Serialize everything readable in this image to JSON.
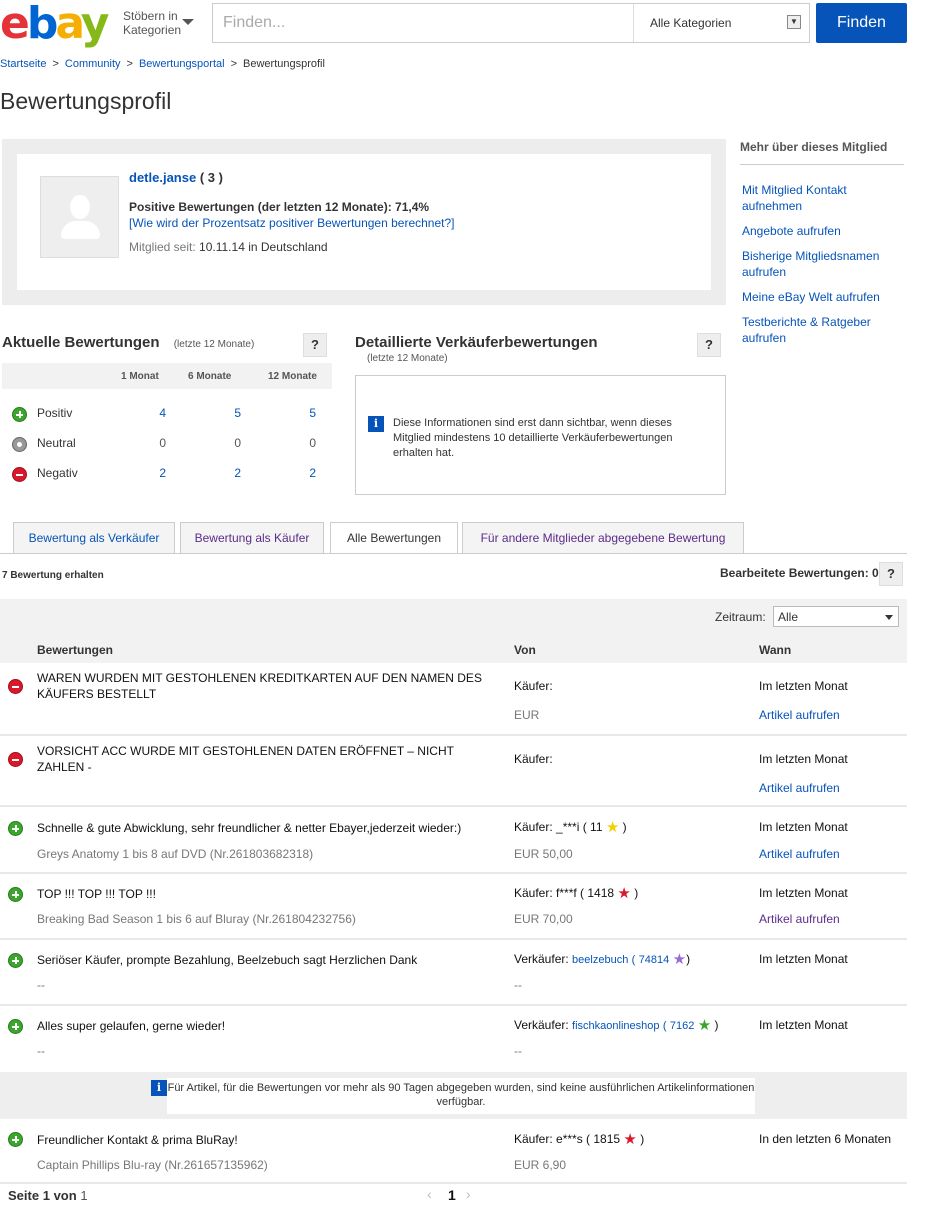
{
  "header": {
    "logo": [
      "e",
      "b",
      "a",
      "y"
    ],
    "browse_line1": "Stöbern in",
    "browse_line2": "Kategorien",
    "search_placeholder": "Finden...",
    "category": "Alle Kategorien",
    "find_button": "Finden"
  },
  "breadcrumb": [
    "Startseite",
    "Community",
    "Bewertungsportal",
    "Bewertungsprofil"
  ],
  "page_title": "Bewertungsprofil",
  "profile": {
    "username": "detle.janse",
    "score": "( 3 )",
    "positive_line": "Positive Bewertungen (der letzten 12 Monate): 71,4%",
    "percent_link": "[Wie wird der Prozentsatz positiver Bewertungen berechnet?]",
    "member_label": "Mitglied seit:",
    "member_value": "10.11.14 in Deutschland"
  },
  "sidebar": {
    "title": "Mehr über dieses Mitglied",
    "links": [
      "Mit Mitglied Kontakt aufnehmen",
      "Angebote aufrufen",
      "Bisherige Mitgliedsnamen aufrufen",
      "Meine eBay Welt aufrufen",
      "Testberichte & Ratgeber aufrufen"
    ]
  },
  "current_ratings": {
    "title": "Aktuelle Bewertungen",
    "subtitle": "(letzte 12 Monate)",
    "help": "?",
    "columns": [
      "1 Monat",
      "6 Monate",
      "12 Monate"
    ],
    "rows": [
      {
        "label": "Positiv",
        "values": [
          "4",
          "5",
          "5"
        ]
      },
      {
        "label": "Neutral",
        "values": [
          "0",
          "0",
          "0"
        ]
      },
      {
        "label": "Negativ",
        "values": [
          "2",
          "2",
          "2"
        ]
      }
    ]
  },
  "seller_ratings": {
    "title": "Detaillierte Verkäuferbewertungen",
    "subtitle": "(letzte 12 Monate)",
    "help": "?",
    "info_icon": "i",
    "info": "Diese Informationen sind erst dann sichtbar, wenn dieses Mitglied mindestens 10 detaillierte Verkäuferbewertungen erhalten hat."
  },
  "tabs": [
    "Bewertung als Verkäufer",
    "Bewertung als Käufer",
    "Alle Bewertungen",
    "Für andere Mitglieder abgegebene Bewertung"
  ],
  "received": "7 Bewertung erhalten",
  "edited": "Bearbeitete Bewertungen: 0",
  "edited_help": "?",
  "filter": {
    "label": "Zeitraum:",
    "value": "Alle"
  },
  "table_headers": [
    "Bewertungen",
    "Von",
    "Wann"
  ],
  "feedback": [
    {
      "type": "negative",
      "text": "WAREN WURDEN MIT GESTOHLENEN KREDITKARTEN AUF DEN NAMEN DES KÄUFERS BESTELLT",
      "item": "",
      "from": "Käufer:",
      "from_user": "",
      "from_score": "",
      "star": "",
      "price": "EUR",
      "when": "Im letzten Monat",
      "link": "Artikel aufrufen"
    },
    {
      "type": "negative",
      "text": "VORSICHT ACC WURDE MIT GESTOHLENEN DATEN ERÖFFNET – NICHT ZAHLEN -",
      "item": "",
      "from": "Käufer:",
      "from_user": "",
      "from_score": "",
      "star": "",
      "price": "",
      "when": "Im letzten Monat",
      "link": "Artikel aufrufen"
    },
    {
      "type": "positive",
      "text": "Schnelle & gute Abwicklung, sehr freundlicher & netter Ebayer,jederzeit wieder:)",
      "item": "Greys Anatomy 1 bis 8 auf DVD (Nr.261803682318)",
      "from": "Käufer: _***i ( 11",
      "star": "yellow",
      "from_end": ")",
      "price": "EUR 50,00",
      "when": "Im letzten Monat",
      "link": "Artikel aufrufen"
    },
    {
      "type": "positive",
      "text": "TOP !!! TOP !!! TOP !!!",
      "item": "Breaking Bad Season 1 bis 6 auf Bluray (Nr.261804232756)",
      "from": "Käufer: f***f ( 1418",
      "star": "red",
      "from_end": ")",
      "price": "EUR 70,00",
      "when": "Im letzten Monat",
      "link": "Artikel aufrufen"
    },
    {
      "type": "positive",
      "text": "Seriöser Käufer, prompte Bezahlung, Beelzebuch sagt Herzlichen Dank",
      "item": "--",
      "from": "Verkäufer:",
      "from_user": "beelzebuch",
      "from_score": "74814",
      "star": "purple",
      "from_end": ")",
      "price": "--",
      "when": "Im letzten Monat",
      "link": ""
    },
    {
      "type": "positive",
      "text": "Alles super gelaufen, gerne wieder!",
      "item": "--",
      "from": "Verkäufer:",
      "from_user": "fischkaonlineshop",
      "from_score": "7162",
      "star": "green",
      "from_end": ")",
      "price": "--",
      "when": "Im letzten Monat",
      "link": ""
    },
    {
      "type": "positive",
      "text": "Freundlicher Kontakt & prima BluRay!",
      "item": "Captain Phillips Blu-ray (Nr.261657135962)",
      "from": "Käufer: e***s ( 1815",
      "star": "red",
      "from_end": ")",
      "price": "EUR 6,90",
      "when": "In den letzten 6 Monaten",
      "link": ""
    }
  ],
  "notice": {
    "icon": "i",
    "text": "Für Artikel, für die Bewertungen vor mehr als 90 Tagen abgegeben wurden, sind keine ausführlichen Artikelinformationen verfügbar."
  },
  "pager": {
    "label": "Seite",
    "current": "1",
    "of": "von",
    "total": "1",
    "page": "1",
    "prev": "‹",
    "next": "›"
  },
  "colors": {
    "accent": "#0654ba",
    "visited": "#5b2c8a",
    "positive": "#3aa62c",
    "negative": "#d9182a"
  }
}
